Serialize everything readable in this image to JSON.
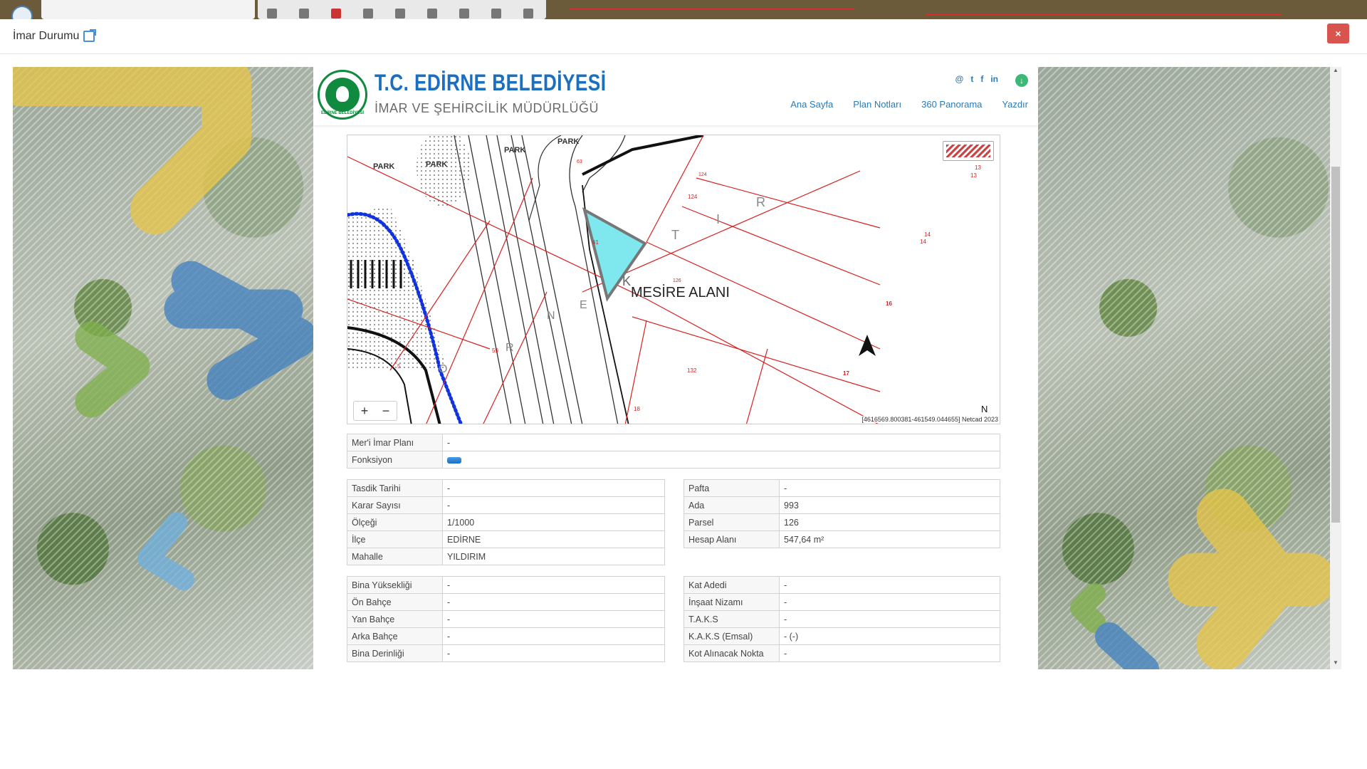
{
  "modal": {
    "title": "İmar Durumu",
    "close_label": "×"
  },
  "site": {
    "title": "T.C. EDİRNE BELEDİYESİ",
    "subtitle": "İMAR VE ŞEHİRCİLİK MÜDÜRLÜĞÜ",
    "logo_text": "EDİRNE BELEDİYESİ",
    "social": [
      "@",
      "t",
      "f",
      "in"
    ],
    "nav": [
      "Ana Sayfa",
      "Plan Notları",
      "360 Panorama",
      "Yazdır"
    ]
  },
  "map": {
    "label_mesire": "MESİRE ALANI",
    "label_park1": "PARK",
    "label_park2": "PARK",
    "label_park3": "PARK",
    "label_park4": "PARK",
    "letters_tir": [
      "T",
      "I",
      "R"
    ],
    "letters_ornek": [
      "O",
      "R",
      "N",
      "E",
      "K"
    ],
    "north": "N",
    "coords": "[4616569.800381-461549.044655] Netcad 2023",
    "zoom_in": "+",
    "zoom_out": "−",
    "parcel_numbers": [
      "13",
      "13",
      "124",
      "124",
      "14",
      "14",
      "16",
      "17",
      "126",
      "132",
      "61",
      "63",
      "59",
      "5",
      "18"
    ],
    "highlight_color": "#7ee8ee"
  },
  "info_top": [
    {
      "key": "Mer'i İmar Planı",
      "value": "-"
    },
    {
      "key": "Fonksiyon",
      "value": ""
    }
  ],
  "info_left": [
    {
      "key": "Tasdik Tarihi",
      "value": "-"
    },
    {
      "key": "Karar Sayısı",
      "value": "-"
    },
    {
      "key": "Ölçeği",
      "value": "1/1000"
    },
    {
      "key": "İlçe",
      "value": "EDİRNE"
    },
    {
      "key": "Mahalle",
      "value": "YILDIRIM"
    }
  ],
  "info_right": [
    {
      "key": "Pafta",
      "value": "-"
    },
    {
      "key": "Ada",
      "value": "993"
    },
    {
      "key": "Parsel",
      "value": "126"
    },
    {
      "key": "Hesap Alanı",
      "value": "547,64 m²"
    }
  ],
  "build_left": [
    {
      "key": "Bina Yüksekliği",
      "value": "-"
    },
    {
      "key": "Ön Bahçe",
      "value": "-"
    },
    {
      "key": "Yan Bahçe",
      "value": "-"
    },
    {
      "key": "Arka Bahçe",
      "value": "-"
    },
    {
      "key": "Bina Derinliği",
      "value": "-"
    }
  ],
  "build_right": [
    {
      "key": "Kat Adedi",
      "value": "-"
    },
    {
      "key": "İnşaat Nizamı",
      "value": "-"
    },
    {
      "key": "T.A.K.S",
      "value": "-"
    },
    {
      "key": "K.A.K.S (Emsal)",
      "value": "- (-)"
    },
    {
      "key": "Kot Alınacak Nokta",
      "value": "-"
    }
  ],
  "colors": {
    "brand_blue": "#1a6fbf",
    "brand_green": "#0f8a3f",
    "close_red": "#d9534f"
  }
}
